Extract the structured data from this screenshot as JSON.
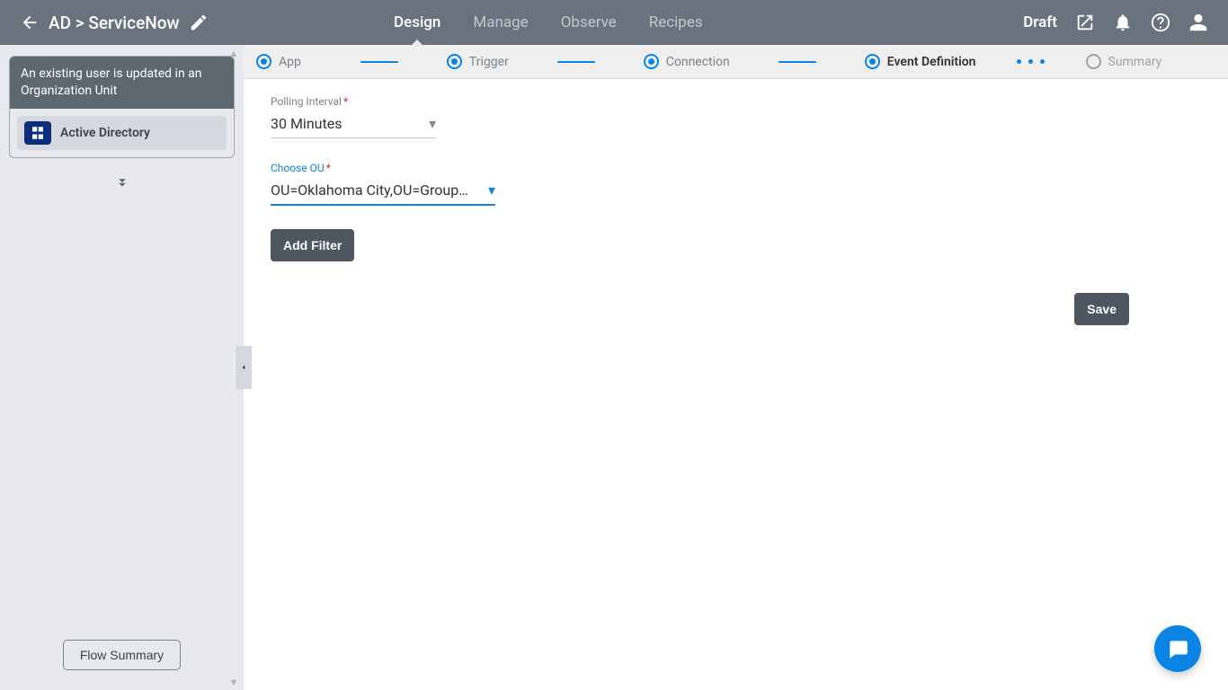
{
  "header": {
    "title": "AD > ServiceNow",
    "status": "Draft",
    "nav": [
      {
        "label": "Design",
        "active": true
      },
      {
        "label": "Manage",
        "active": false
      },
      {
        "label": "Observe",
        "active": false
      },
      {
        "label": "Recipes",
        "active": false
      }
    ]
  },
  "sidebar": {
    "card_title": "An existing user is updated in an Organization Unit",
    "app_name": "Active Directory",
    "flow_summary_label": "Flow Summary"
  },
  "stepper": [
    {
      "label": "App",
      "state": "done"
    },
    {
      "label": "Trigger",
      "state": "done"
    },
    {
      "label": "Connection",
      "state": "done"
    },
    {
      "label": "Event Definition",
      "state": "current"
    },
    {
      "label": "Summary",
      "state": "inactive"
    }
  ],
  "form": {
    "polling_interval_label": "Polling Interval",
    "polling_interval_value": "30 Minutes",
    "choose_ou_label": "Choose OU",
    "choose_ou_value": "OU=Oklahoma City,OU=Groups,DC=…",
    "add_filter_label": "Add Filter",
    "save_label": "Save"
  }
}
